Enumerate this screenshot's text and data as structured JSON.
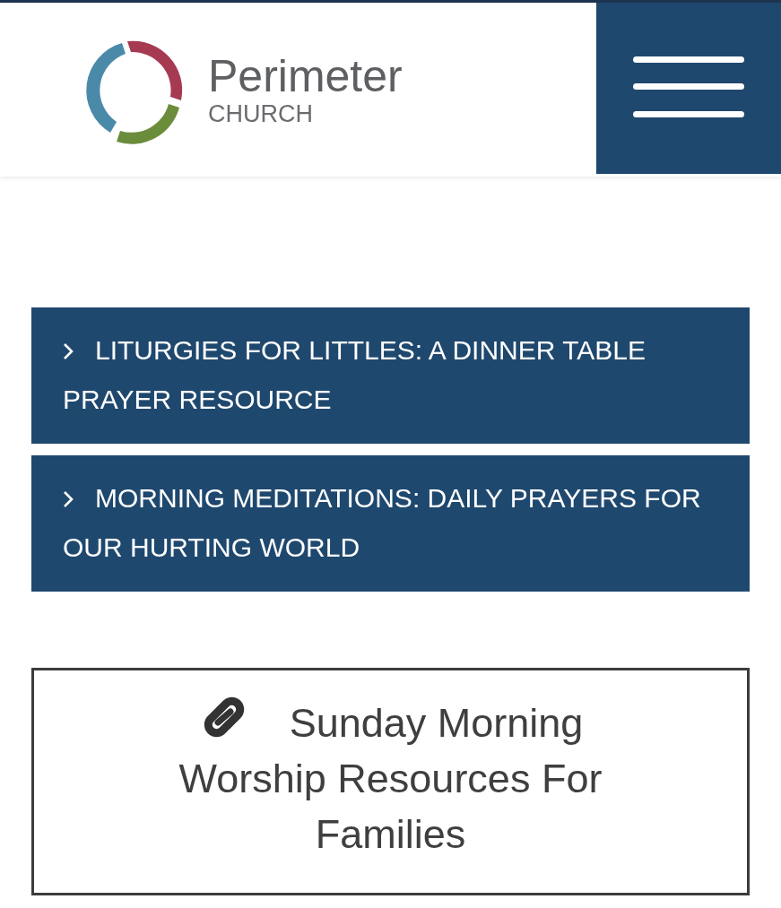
{
  "header": {
    "logo": {
      "name": "Perimeter",
      "subtitle": "CHURCH"
    }
  },
  "accordions": [
    {
      "title": "LITURGIES FOR LITTLES: A DINNER TABLE PRAYER RESOURCE",
      "expanded": false
    },
    {
      "title": "MORNING MEDITATIONS: DAILY PRAYERS FOR OUR HURTING WORLD",
      "expanded": false
    }
  ],
  "link_box": {
    "text": "Sunday Morning Worship Resources For Families"
  }
}
